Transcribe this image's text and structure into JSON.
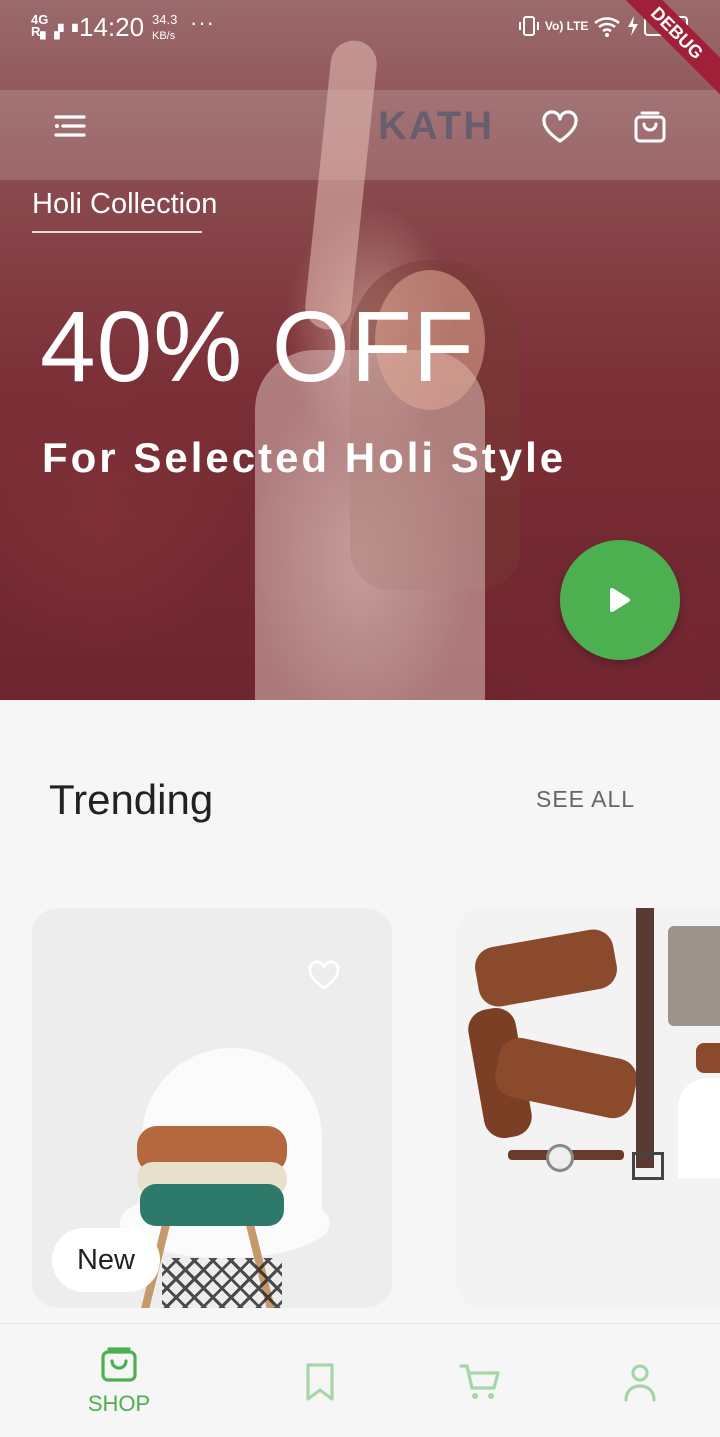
{
  "status_bar": {
    "network": "4G",
    "time": "14:20",
    "speed_value": "34.3",
    "speed_unit": "KB/s",
    "more": "···",
    "signal_right": "Vo) LTE",
    "battery": "44",
    "debug_banner": "DEBUG"
  },
  "hero": {
    "collection_label": "Holi Collection",
    "headline": "40% OFF",
    "subheadline": "For Selected Holi Style",
    "background_sign_text": "KATH",
    "play_button_color": "#4caf50"
  },
  "top_bar_icons": [
    "menu-icon",
    "heart-icon",
    "shopping-bag-icon"
  ],
  "trending": {
    "title": "Trending",
    "see_all": "SEE ALL",
    "cards": [
      {
        "badge": "New",
        "image": "knitwear-on-chair",
        "favorite": false
      },
      {
        "image": "boots-belt-watch-flatlay"
      }
    ]
  },
  "bottom_nav": {
    "active_color": "#4caf50",
    "inactive_color": "#a5d6a7",
    "items": [
      {
        "label": "SHOP",
        "icon": "shopping-bag-icon",
        "active": true
      },
      {
        "label": "",
        "icon": "bookmark-icon",
        "active": false
      },
      {
        "label": "",
        "icon": "cart-icon",
        "active": false
      },
      {
        "label": "",
        "icon": "user-icon",
        "active": false
      }
    ]
  }
}
